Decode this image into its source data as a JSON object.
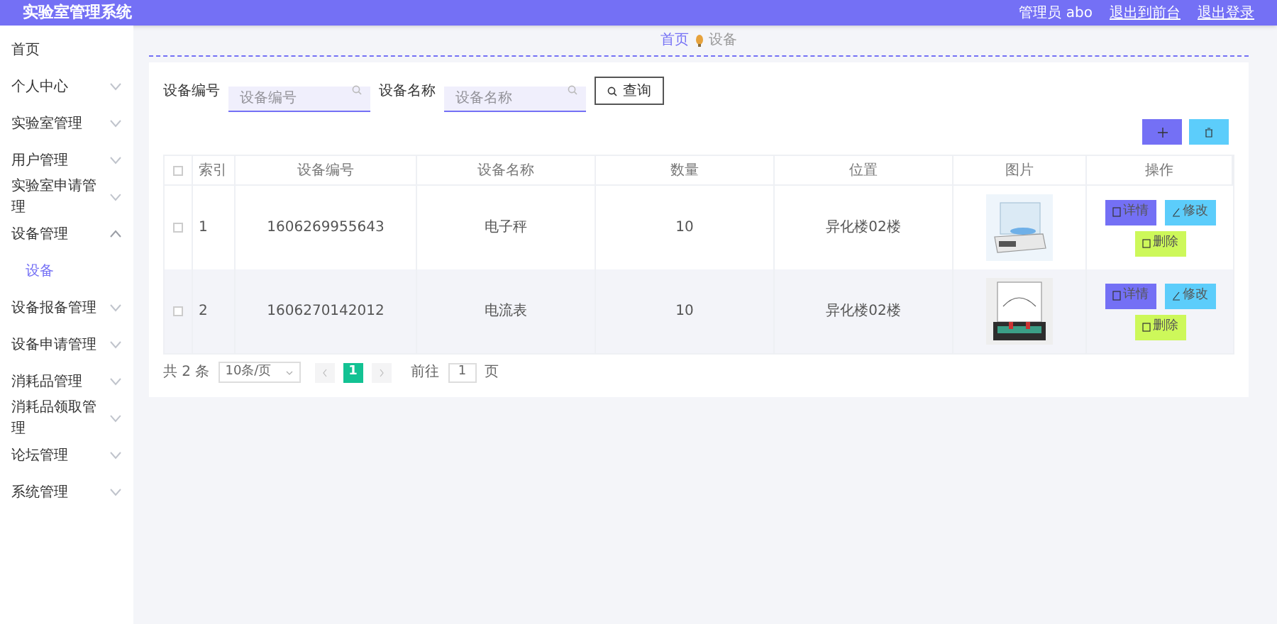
{
  "header": {
    "title": "实验室管理系统",
    "user": "管理员 abo",
    "links": [
      "退出到前台",
      "退出登录"
    ]
  },
  "sidebar": {
    "items": [
      {
        "label": "首页"
      },
      {
        "label": "个人中心",
        "expanded": false
      },
      {
        "label": "实验室管理",
        "expanded": false
      },
      {
        "label": "用户管理",
        "expanded": false
      },
      {
        "label": "实验室申请管理",
        "expanded": false
      },
      {
        "label": "设备管理",
        "expanded": true,
        "children": [
          {
            "label": "设备",
            "selected": true
          }
        ]
      },
      {
        "label": "设备报备管理",
        "expanded": false
      },
      {
        "label": "设备申请管理",
        "expanded": false
      },
      {
        "label": "消耗品管理",
        "expanded": false
      },
      {
        "label": "消耗品领取管理",
        "expanded": false
      },
      {
        "label": "论坛管理",
        "expanded": false
      },
      {
        "label": "系统管理",
        "expanded": false
      }
    ]
  },
  "breadcrumb": [
    "首页",
    "设备"
  ],
  "search": {
    "fields": [
      {
        "label": "设备编号",
        "placeholder": "设备编号"
      },
      {
        "label": "设备名称",
        "placeholder": "设备名称"
      }
    ],
    "button": "查询"
  },
  "table": {
    "all_checked": false,
    "columns": [
      "索引",
      "设备编号",
      "设备名称",
      "数量",
      "位置",
      "图片",
      "操作"
    ],
    "rows": [
      {
        "checked": false,
        "cells": [
          "1",
          "1606269955643",
          "电子秤",
          "10",
          "异化楼02楼"
        ],
        "kind": "scale",
        "actions": [
          "详情",
          "修改",
          "删除"
        ]
      },
      {
        "checked": false,
        "cells": [
          "2",
          "1606270142012",
          "电流表",
          "10",
          "异化楼02楼"
        ],
        "kind": "meter",
        "actions": [
          "详情",
          "修改",
          "删除"
        ]
      }
    ]
  },
  "pagination": {
    "total": "共 2 条",
    "page_size": "10条/页",
    "pages": [
      {
        "label": "1",
        "selected": true
      }
    ],
    "goto_label": "前往",
    "goto_value": "1",
    "goto_suffix": "页"
  }
}
